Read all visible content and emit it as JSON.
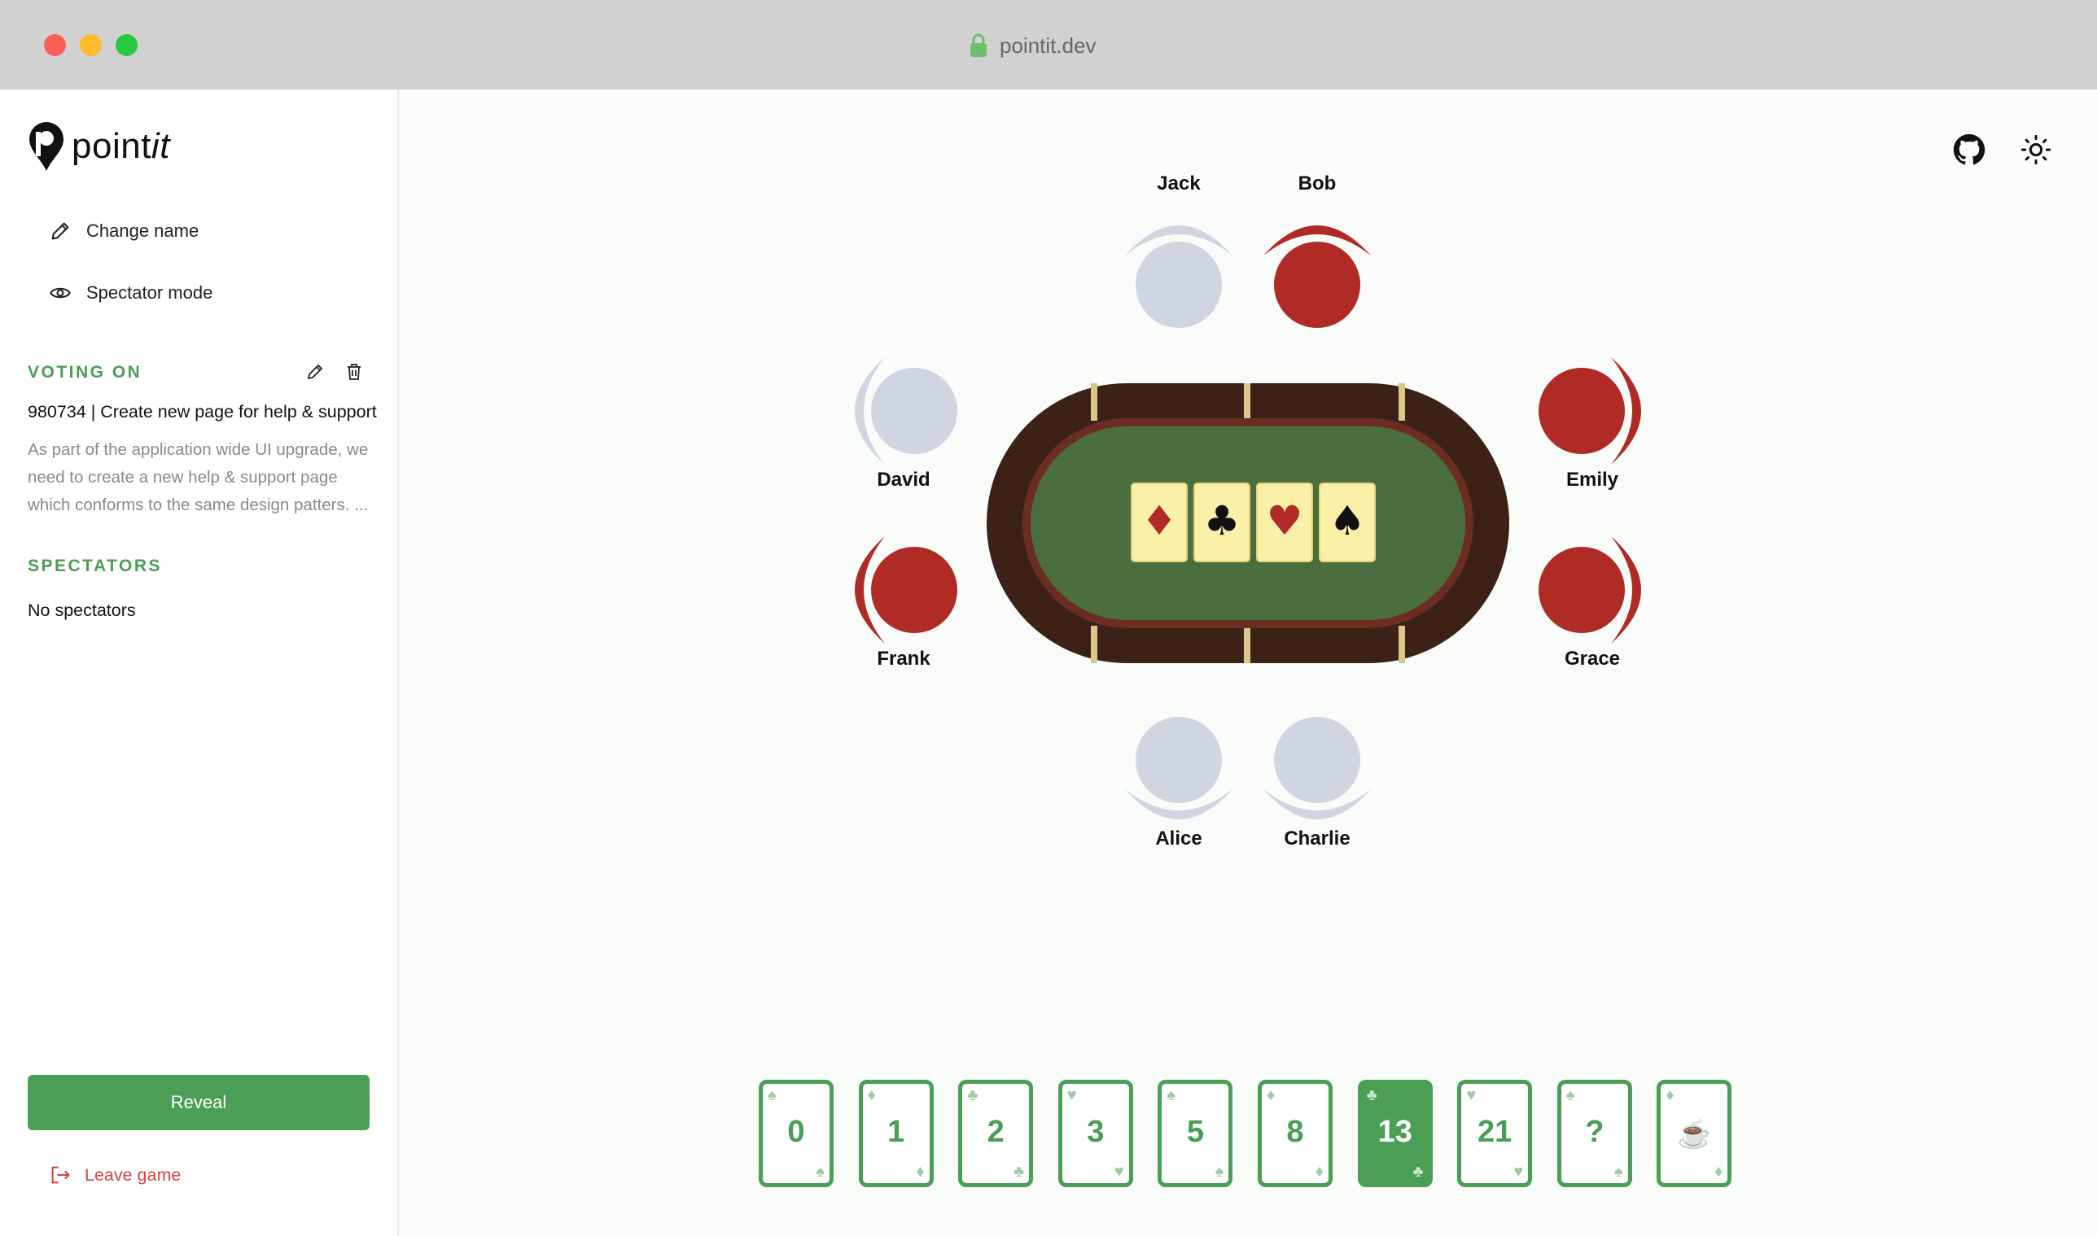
{
  "browser": {
    "url": "pointit.dev"
  },
  "sidebar": {
    "logo_prefix": "point",
    "logo_suffix": "it",
    "menu": [
      {
        "label": "Change name",
        "icon": "pencil-icon"
      },
      {
        "label": "Spectator mode",
        "icon": "eye-icon"
      }
    ],
    "voting_title": "VOTING ON",
    "issue_title": "980734 | Create new page for help & support",
    "issue_description": "As part of the application wide UI upgrade, we need to create a new help & support page which conforms to the same design patters. ...",
    "spectators_title": "SPECTATORS",
    "spectators_empty": "No spectators",
    "reveal_label": "Reveal",
    "leave_label": "Leave game"
  },
  "players": [
    {
      "name": "Jack",
      "voted": false
    },
    {
      "name": "Bob",
      "voted": true
    },
    {
      "name": "David",
      "voted": false
    },
    {
      "name": "Emily",
      "voted": true
    },
    {
      "name": "Frank",
      "voted": true
    },
    {
      "name": "Grace",
      "voted": true
    },
    {
      "name": "Alice",
      "voted": false
    },
    {
      "name": "Charlie",
      "voted": false
    }
  ],
  "table_suits": [
    "♦",
    "♣",
    "♥",
    "♠"
  ],
  "cards": [
    {
      "value": "0",
      "suit": "♠",
      "selected": false
    },
    {
      "value": "1",
      "suit": "♦",
      "selected": false
    },
    {
      "value": "2",
      "suit": "♣",
      "selected": false
    },
    {
      "value": "3",
      "suit": "♥",
      "selected": false
    },
    {
      "value": "5",
      "suit": "♠",
      "selected": false
    },
    {
      "value": "8",
      "suit": "♦",
      "selected": false
    },
    {
      "value": "13",
      "suit": "♣",
      "selected": true
    },
    {
      "value": "21",
      "suit": "♥",
      "selected": false
    },
    {
      "value": "?",
      "suit": "♠",
      "selected": false
    },
    {
      "value": "☕",
      "suit": "♦",
      "selected": false
    }
  ],
  "colors": {
    "accent": "#4a9e55",
    "voted": "#b02b26",
    "empty_seat": "#cfd6e2",
    "felt": "#4c6e3f",
    "table_wood": "#3c2117",
    "table_card": "#fbf0a8",
    "leave": "#d8433b"
  }
}
